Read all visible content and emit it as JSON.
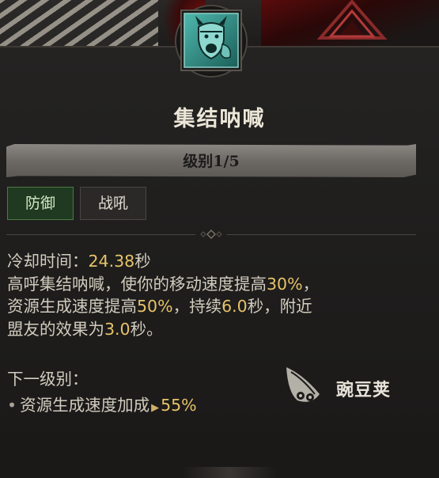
{
  "skill": {
    "icon": "horned-helmet-shouting-face-icon",
    "name": "集结呐喊",
    "level_label": "级别1/5"
  },
  "tags": [
    "防御",
    "战吼"
  ],
  "details": {
    "cooldown_label": "冷却时间：",
    "cooldown_value": "24.38",
    "cooldown_unit": "秒",
    "desc_line1_a": "高呼集结呐喊，使你的移动速度提高",
    "desc_line1_val": "30%",
    "desc_line1_b": "，",
    "desc_line2_a": "资源生成速度提高",
    "desc_line2_val": "50%",
    "desc_line2_b": "，持续",
    "desc_line2_val2": "6.0",
    "desc_line2_c": "秒，附近",
    "desc_line3_a": "盟友的效果为",
    "desc_line3_val": "3.0",
    "desc_line3_b": "秒。"
  },
  "next_level": {
    "heading": "下一级别：",
    "stat_label": "资源生成速度加成",
    "stat_value": "55%"
  },
  "watermark": {
    "text": "豌豆荚",
    "icon": "wandoujia-logo-icon"
  },
  "colors": {
    "highlight": "#e6c36a",
    "defense_tag_bg": "#1f3a20",
    "icon_teal": "#2d8f86"
  }
}
